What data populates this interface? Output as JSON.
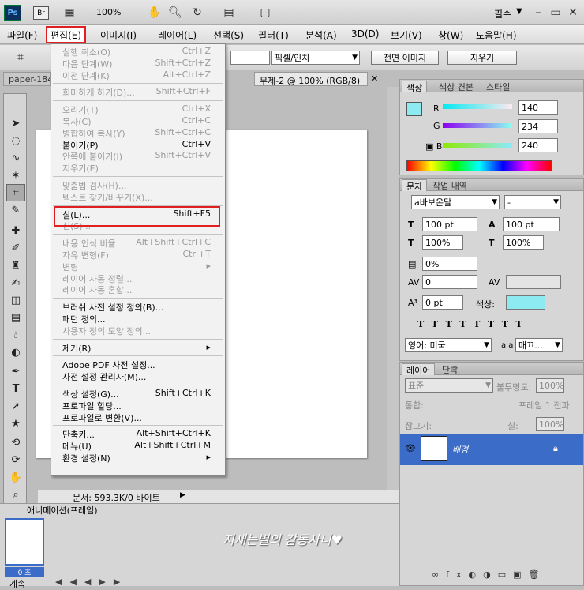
{
  "appbar": {
    "ps_label": "Ps",
    "br_label": "Br",
    "zoom": "100%",
    "workspace": "필수"
  },
  "menubar": {
    "items": [
      "파일(F)",
      "편집(E)",
      "이미지(I)",
      "레이어(L)",
      "선택(S)",
      "필터(T)",
      "분석(A)",
      "3D(D)",
      "보기(V)",
      "창(W)",
      "도움말(H)"
    ]
  },
  "options": {
    "unit": "픽셀/인치",
    "front_image": "전면 이미지",
    "clear": "지우기"
  },
  "tabs": [
    "paper-184",
    "무제-2 @ 100% (RGB/8)"
  ],
  "status": {
    "doc": "문서: 593.3K/0 바이트"
  },
  "edit_menu": [
    {
      "label": "실행 취소(O)",
      "shortcut": "Ctrl+Z",
      "disabled": true
    },
    {
      "label": "다음 단계(W)",
      "shortcut": "Shift+Ctrl+Z",
      "disabled": true
    },
    {
      "label": "이전 단계(K)",
      "shortcut": "Alt+Ctrl+Z",
      "disabled": true
    },
    {
      "sep": true
    },
    {
      "label": "희미하게 하기(D)...",
      "shortcut": "Shift+Ctrl+F",
      "disabled": true
    },
    {
      "sep": true
    },
    {
      "label": "오리기(T)",
      "shortcut": "Ctrl+X",
      "disabled": true
    },
    {
      "label": "복사(C)",
      "shortcut": "Ctrl+C",
      "disabled": true
    },
    {
      "label": "병합하여 복사(Y)",
      "shortcut": "Shift+Ctrl+C",
      "disabled": true
    },
    {
      "label": "붙이기(P)",
      "shortcut": "Ctrl+V",
      "disabled": false
    },
    {
      "label": "안쪽에 붙이기(I)",
      "shortcut": "Shift+Ctrl+V",
      "disabled": true
    },
    {
      "label": "지우기(E)",
      "shortcut": "",
      "disabled": true
    },
    {
      "sep": true
    },
    {
      "label": "맞춤법 검사(H)...",
      "shortcut": "",
      "disabled": true
    },
    {
      "label": "텍스트 찾기/바꾸기(X)...",
      "shortcut": "",
      "disabled": true
    },
    {
      "sep": true
    },
    {
      "label": "칠(L)...",
      "shortcut": "Shift+F5",
      "disabled": false
    },
    {
      "label": "선(S)...",
      "shortcut": "",
      "disabled": true
    },
    {
      "sep": true
    },
    {
      "label": "내용 인식 비율",
      "shortcut": "Alt+Shift+Ctrl+C",
      "disabled": true
    },
    {
      "label": "자유 변형(F)",
      "shortcut": "Ctrl+T",
      "disabled": true
    },
    {
      "label": "변형",
      "shortcut": "▸",
      "disabled": true
    },
    {
      "label": "레이어 자동 정렬...",
      "shortcut": "",
      "disabled": true
    },
    {
      "label": "레이어 자동 혼합...",
      "shortcut": "",
      "disabled": true
    },
    {
      "sep": true
    },
    {
      "label": "브러쉬 사전 설정 정의(B)...",
      "shortcut": "",
      "disabled": false
    },
    {
      "label": "패턴 정의...",
      "shortcut": "",
      "disabled": false
    },
    {
      "label": "사용자 정의 모양 정의...",
      "shortcut": "",
      "disabled": true
    },
    {
      "sep": true
    },
    {
      "label": "제거(R)",
      "shortcut": "▸",
      "disabled": false
    },
    {
      "sep": true
    },
    {
      "label": "Adobe PDF 사전 설정...",
      "shortcut": "",
      "disabled": false
    },
    {
      "label": "사전 설정 관리자(M)...",
      "shortcut": "",
      "disabled": false
    },
    {
      "sep": true
    },
    {
      "label": "색상 설정(G)...",
      "shortcut": "Shift+Ctrl+K",
      "disabled": false
    },
    {
      "label": "프로파일 할당...",
      "shortcut": "",
      "disabled": false
    },
    {
      "label": "프로파일로 변환(V)...",
      "shortcut": "",
      "disabled": false
    },
    {
      "sep": true
    },
    {
      "label": "단축키...",
      "shortcut": "Alt+Shift+Ctrl+K",
      "disabled": false
    },
    {
      "label": "메뉴(U)",
      "shortcut": "Alt+Shift+Ctrl+M",
      "disabled": false
    },
    {
      "label": "환경 설정(N)",
      "shortcut": "▸",
      "disabled": false
    }
  ],
  "color_panel": {
    "tabs": [
      "색상",
      "색상 견본",
      "스타일"
    ],
    "r": "140",
    "g": "234",
    "b": "240",
    "swatch": "#8ceaf0"
  },
  "char_panel": {
    "tabs": [
      "문자",
      "작업 내역"
    ],
    "font": "a바보온달",
    "style": "-",
    "size": "100 pt",
    "leading": "100 pt",
    "vscale": "100%",
    "hscale": "100%",
    "tracking": "0%",
    "kerning": "0",
    "baseline": "0 pt",
    "color_label": "색상:",
    "lang": "영어: 미국",
    "aa": "매끄...",
    "aa_label": "a a"
  },
  "layers_panel": {
    "tabs": [
      "레이어",
      "단락"
    ],
    "blend": "표준",
    "opacity_label": "불투명도:",
    "opacity": "100%",
    "lock_label": "잠그기:",
    "frame_label": "프레임 1 전파",
    "unify_label": "통합:",
    "fill_label": "칠:",
    "fill": "100%",
    "layer_name": "배경"
  },
  "timeline": {
    "title": "애니메이션(프레임)",
    "frame_time": "0 초",
    "loop": "계속"
  },
  "watermark": "지새는별의 감동사니♥"
}
